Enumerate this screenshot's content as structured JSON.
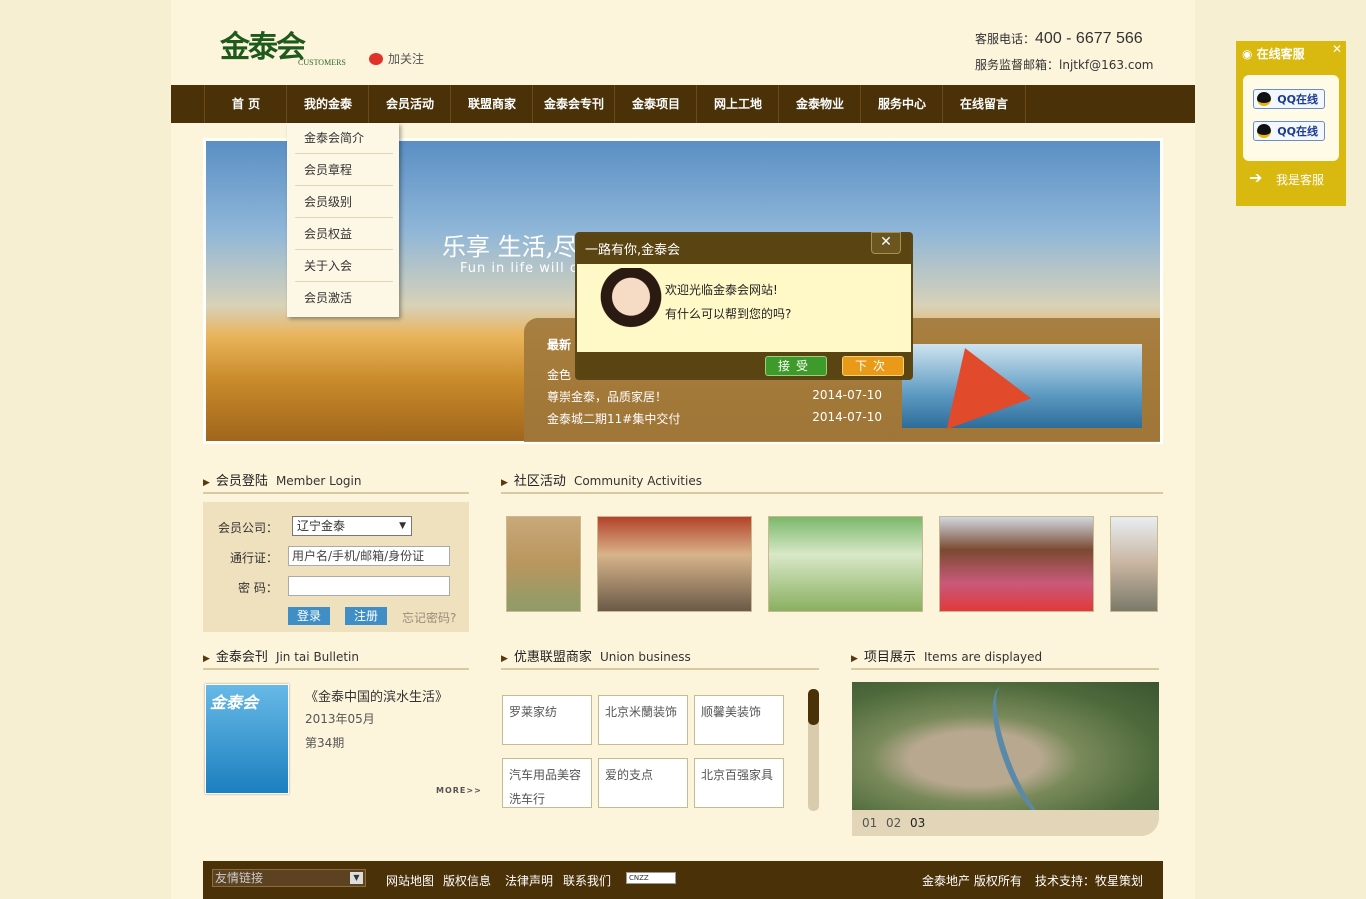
{
  "header": {
    "logo_text": "金泰会",
    "logo_sub": "CUSTOMERS",
    "weibo_label": "加关注",
    "hotline_label": "客服电话：",
    "hotline_number": "400 - 6677 566",
    "email_line": "服务监督邮箱：lnjtkf@163.com"
  },
  "nav": [
    "首 页",
    "我的金泰",
    "会员活动",
    "联盟商家",
    "金泰会专刊",
    "金泰项目",
    "网上工地",
    "金泰物业",
    "服务中心",
    "在线留言"
  ],
  "dropdown": [
    "金泰会简介",
    "会员章程",
    "会员级别",
    "会员权益",
    "关于入会",
    "会员激活"
  ],
  "banner": {
    "slogan": "乐享 生活,尽",
    "slogan_en": "Fun in life will c",
    "news_title": "最新",
    "news": [
      {
        "title": "金色",
        "date": ""
      },
      {
        "title": "尊崇金泰，品质家居！",
        "date": "2014-07-10"
      },
      {
        "title": "金泰城二期11#集中交付",
        "date": "2014-07-10"
      }
    ]
  },
  "popup": {
    "title": "一路有你,金泰会",
    "close": "✕",
    "line1": "欢迎光临金泰会网站!",
    "line2": "有什么可以帮到您的吗?",
    "accept": "接受",
    "next": "下次"
  },
  "login": {
    "heading": "会员登陆",
    "heading_en": "Member Login",
    "company_label": "会员公司：",
    "company_value": "辽宁金泰",
    "pass_label": "通行证：",
    "pass_placeholder": "用户名/手机/邮箱/身份证",
    "pwd_label": "密 码：",
    "login_btn": "登录",
    "register_btn": "注册",
    "forgot": "忘记密码?"
  },
  "community": {
    "heading": "社区活动",
    "heading_en": "Community Activities"
  },
  "bulletin": {
    "heading": "金泰会刊",
    "heading_en": "Jin tai Bulletin",
    "cover_text": "金泰会",
    "title": "《金泰中国的滨水生活》",
    "date": "2013年05月",
    "issue": "第34期",
    "more": "MORE>>"
  },
  "union": {
    "heading": "优惠联盟商家",
    "heading_en": "Union business",
    "items": [
      "罗莱家纺",
      "北京米蘭装饰",
      "顺馨美装饰",
      "汽车用品美容洗车行",
      "爱的支点",
      "北京百强家具"
    ]
  },
  "project": {
    "heading": "项目展示",
    "heading_en": "Items are displayed",
    "pages": [
      "01",
      "02",
      "03"
    ]
  },
  "footer": {
    "friend_links": "友情链接",
    "links": [
      "网站地图",
      "版权信息",
      "法律声明",
      "联系我们"
    ],
    "cnzz": "CNZZ",
    "copyright": "金泰地产 版权所有",
    "support": "技术支持：牧星策划"
  },
  "service": {
    "title": "在线客服",
    "qq1": "QQ在线",
    "qq2": "QQ在线",
    "me": "我是客服"
  },
  "colors": {
    "nav_bg": "#4a3108",
    "page_bg": "#fdf4dc",
    "accent_blue": "#3f8ec6",
    "service_yellow": "#d9b810"
  }
}
